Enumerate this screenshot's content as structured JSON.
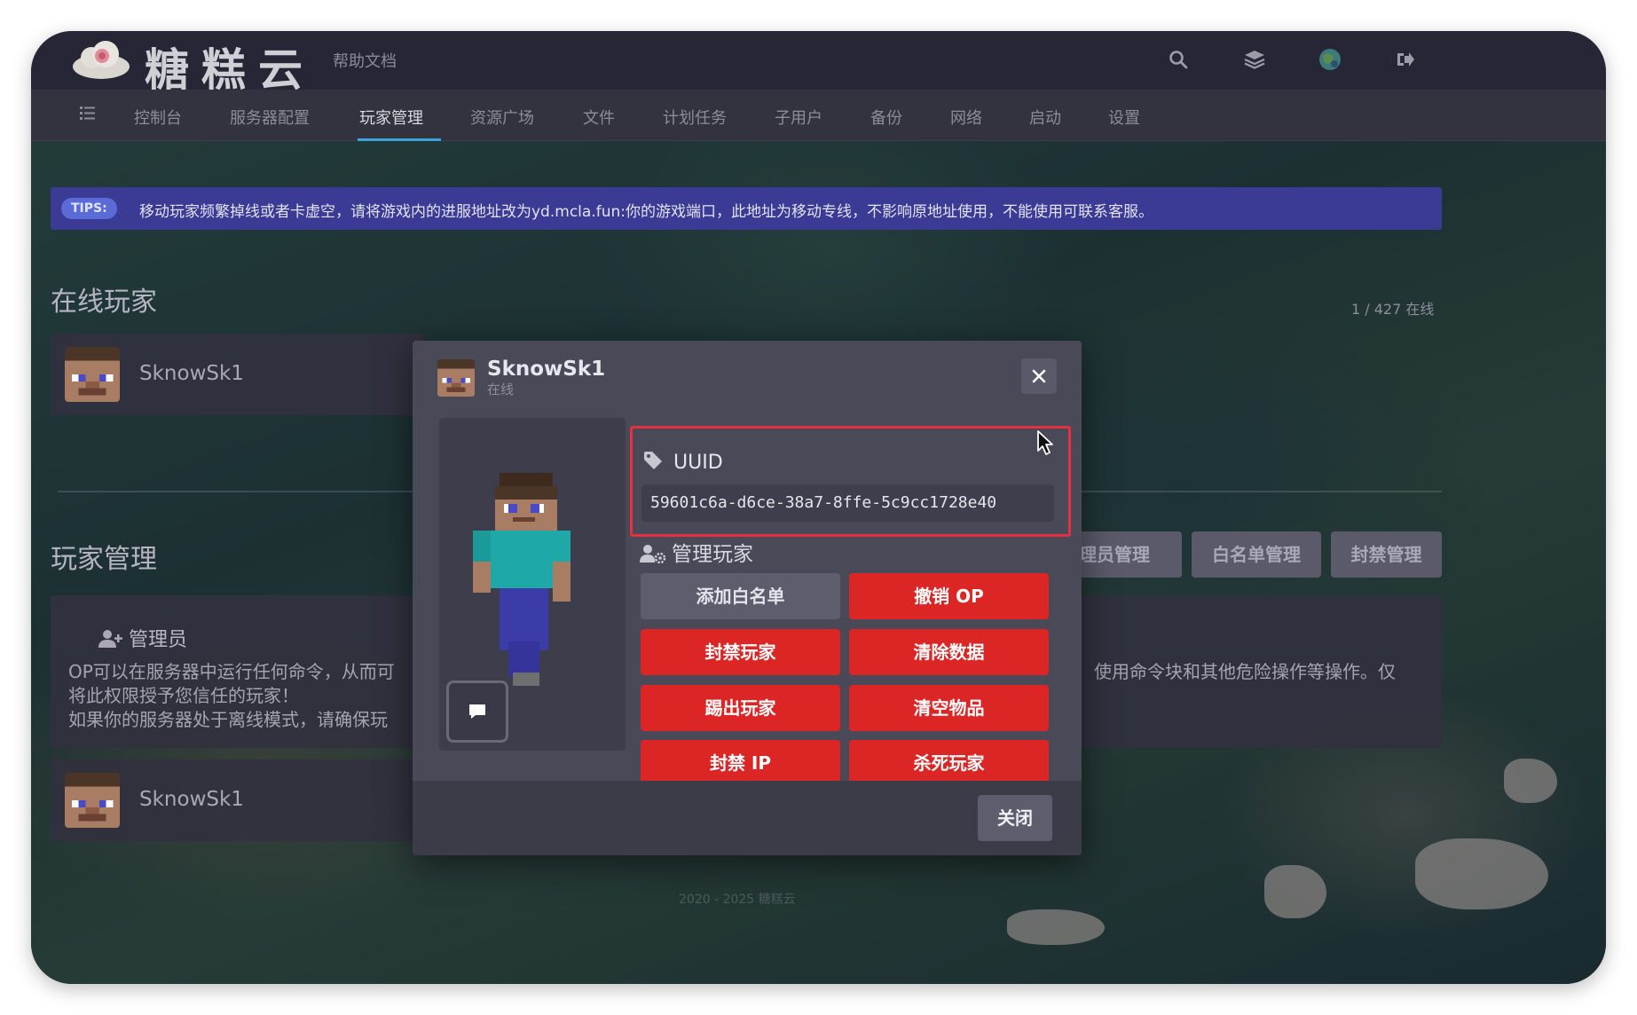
{
  "header": {
    "logo_text": "糖糕云",
    "help_link": "帮助文档"
  },
  "nav": {
    "items": [
      "控制台",
      "服务器配置",
      "玩家管理",
      "资源广场",
      "文件",
      "计划任务",
      "子用户",
      "备份",
      "网络",
      "启动",
      "设置"
    ],
    "active": "玩家管理"
  },
  "tips": {
    "badge": "TIPS:",
    "text": "移动玩家频繁掉线或者卡虚空，请将游戏内的进服地址改为yd.mcla.fun:你的游戏端口，此地址为移动专线，不影响原地址使用，不能使用可联系客服。"
  },
  "online": {
    "title": "在线玩家",
    "count": "1 / 427 在线",
    "players": [
      {
        "name": "SknowSk1"
      }
    ]
  },
  "player_management": {
    "title": "玩家管理",
    "tabs": [
      "管理员管理",
      "白名单管理",
      "封禁管理"
    ],
    "visible_tab_fragment": "理员管理",
    "admin": {
      "heading": "管理员",
      "line1_left": "OP可以在服务器中运行任何命令，从而可",
      "line1_right": "使用命令块和其他危险操作等操作。仅",
      "line2": "将此权限授予您信任的玩家！",
      "line3": "如果你的服务器处于离线模式，请确保玩"
    },
    "admins": [
      {
        "name": "SknowSk1"
      }
    ]
  },
  "footer": "2020 - 2025 糖糕云",
  "modal": {
    "player_name": "SknowSk1",
    "status": "在线",
    "uuid_label": "UUID",
    "uuid": "59601c6a-d6ce-38a7-8ffe-5c9cc1728e40",
    "manage_label": "管理玩家",
    "actions": {
      "add_whitelist": "添加白名单",
      "revoke_op": "撤销 OP",
      "ban_player": "封禁玩家",
      "clear_data": "清除数据",
      "kick_player": "踢出玩家",
      "clear_items": "清空物品",
      "ban_ip": "封禁 IP",
      "kill_player": "杀死玩家"
    },
    "close": "关闭"
  },
  "colors": {
    "accent": "#3ea3d9",
    "danger": "#dc2626",
    "tips_bg": "#3b3a95",
    "highlight_border": "#e4303f"
  }
}
